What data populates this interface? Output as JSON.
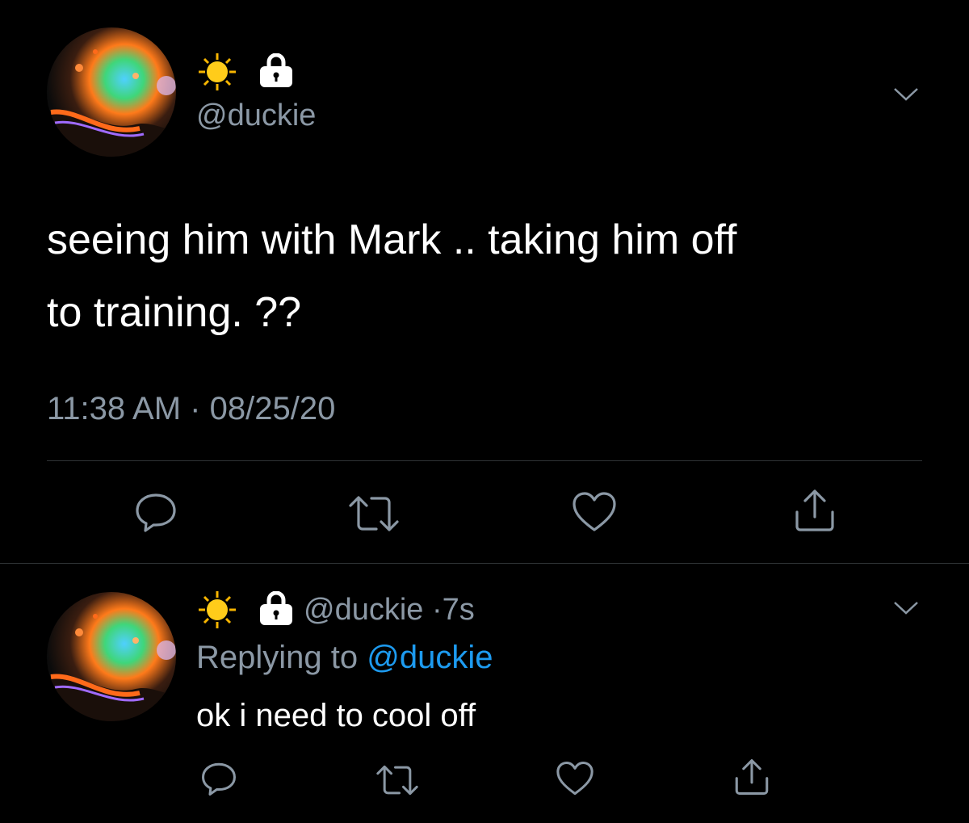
{
  "main_tweet": {
    "author": {
      "emoji": "sun-emoji",
      "lock": "lock-icon",
      "handle": "@duckie"
    },
    "text_line1": "seeing him with Mark .. taking him off",
    "text_line2": "to training. ??",
    "time": "11:38 AM",
    "separator": "·",
    "date": "08/25/20",
    "actions": [
      "reply-icon",
      "retweet-icon",
      "like-icon",
      "share-icon"
    ]
  },
  "reply_tweet": {
    "author": {
      "emoji": "sun-emoji",
      "lock": "lock-icon",
      "handle": "@duckie"
    },
    "age_separator": "·",
    "age": "7s",
    "replying_prefix": "Replying to",
    "replying_handle": "@duckie",
    "text": "ok i need to cool off",
    "actions": [
      "reply-icon",
      "retweet-icon",
      "like-icon",
      "share-icon"
    ]
  },
  "colors": {
    "background": "#000000",
    "text": "#ffffff",
    "muted": "#8b98a5",
    "link": "#1d9bf0",
    "divider": "#2f3336"
  }
}
